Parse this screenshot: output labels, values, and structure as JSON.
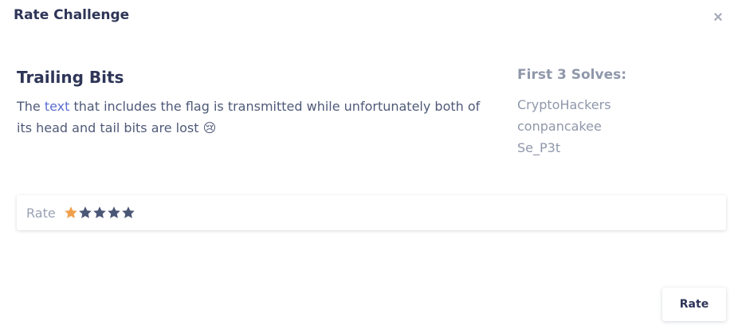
{
  "modal": {
    "title": "Rate Challenge",
    "close_label": "×"
  },
  "challenge": {
    "name": "Trailing Bits",
    "description_before": "The ",
    "description_link": "text",
    "description_after": " that includes the flag is transmitted while unfortunately both of its head and tail bits are lost 😢"
  },
  "solves": {
    "title": "First 3 Solves:",
    "names": [
      "CryptoHackers",
      "conpancakee",
      "Se_P3t"
    ]
  },
  "rating": {
    "label": "Rate",
    "value": 1,
    "max": 5,
    "active_color": "#f0a04b",
    "inactive_color": "#4a5675"
  },
  "footer": {
    "rate_button_label": "Rate"
  }
}
